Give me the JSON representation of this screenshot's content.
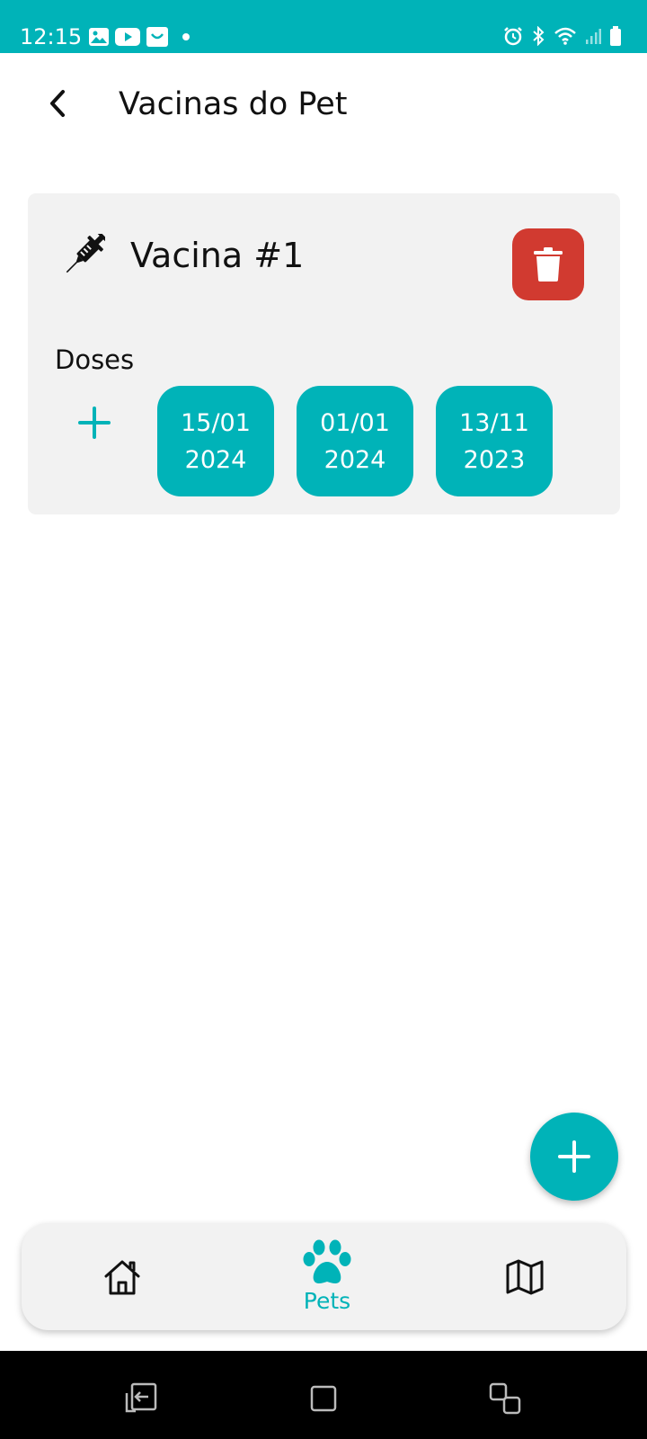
{
  "status_bar": {
    "time": "12:15",
    "left_icons": [
      "gallery-icon",
      "youtube-icon",
      "shopping-icon",
      "dot-icon"
    ],
    "right_icons": [
      "alarm-icon",
      "bluetooth-icon",
      "wifi-icon",
      "signal-icon",
      "battery-icon"
    ]
  },
  "app_bar": {
    "title": "Vacinas do Pet",
    "back_icon": "chevron-left-icon"
  },
  "vaccine_card": {
    "name": "Vacina #1",
    "icon": "syringe-icon",
    "delete_icon": "trash-icon",
    "doses_label": "Doses",
    "add_dose_icon": "plus-icon",
    "doses": [
      {
        "day_month": "15/01",
        "year": "2024"
      },
      {
        "day_month": "01/01",
        "year": "2024"
      },
      {
        "day_month": "13/11",
        "year": "2023"
      }
    ]
  },
  "fab": {
    "icon": "plus-icon"
  },
  "bottom_nav": {
    "items": [
      {
        "icon": "home-icon",
        "label": ""
      },
      {
        "icon": "paw-icon",
        "label": "Pets"
      },
      {
        "icon": "map-icon",
        "label": ""
      }
    ],
    "active_index": 1
  },
  "colors": {
    "accent": "#00b3b8",
    "danger": "#d13a30",
    "card_bg": "#f2f2f2",
    "text": "#111111"
  }
}
